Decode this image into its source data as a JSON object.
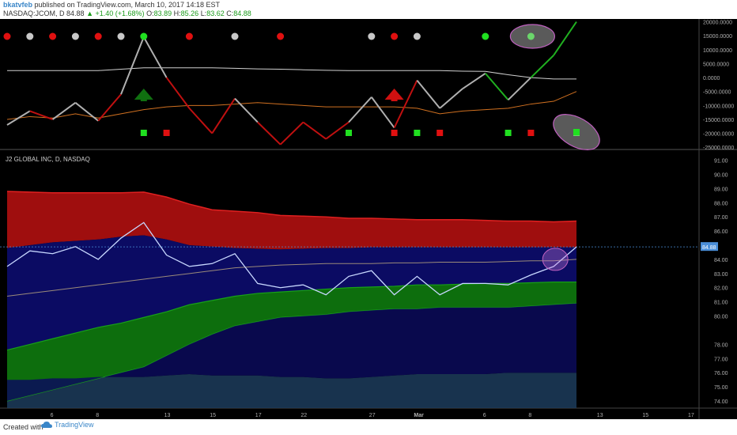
{
  "header": {
    "author": "bkatvfeb",
    "published": "published on TradingView.com, March 10, 2017 14:18 EST",
    "symbol": "NASDAQ:JCOM, D",
    "price": "84.88",
    "change_arrow": "▲",
    "change": "+1.40 (+1.68%)",
    "o_label": "O:",
    "o_value": "83.89",
    "h_label": "H:",
    "h_value": "85.26",
    "l_label": "L:",
    "l_value": "83.62",
    "c_label": "C:",
    "c_value": "84.88"
  },
  "footer": {
    "created": "Created with",
    "brand": "TradingView"
  },
  "colors": {
    "background": "#000000",
    "red_band": "#b01010",
    "blue_band": "#0c0c6e",
    "green_band": "#0e7a0e",
    "price_line": "#c8d8ff",
    "osc_red": "#c01010",
    "osc_grey": "#b0b0b0",
    "osc_green": "#20b020",
    "orange_ma": "#d07020",
    "last_price_tag": "#4a8ed8",
    "highlight_ellipse": "#c060c0"
  },
  "chart_data": [
    {
      "type": "line",
      "panel": "oscillator",
      "y_ticks": [
        20000,
        15000,
        10000,
        5000,
        0,
        -5000,
        -10000,
        -15000,
        -20000,
        -25000
      ],
      "y_tick_labels": [
        "20000.0000",
        "15000.0000",
        "10000.0000",
        "5000.0000",
        "0.0000",
        "-5000.0000",
        "-10000.0000",
        "-15000.0000",
        "-20000.0000",
        "-25000.0000"
      ],
      "ylim": [
        -25500,
        21000
      ],
      "x": [
        0,
        1,
        2,
        3,
        4,
        5,
        6,
        7,
        8,
        9,
        10,
        11,
        12,
        13,
        14,
        15,
        16,
        17,
        18,
        19,
        20,
        21,
        22,
        23,
        24,
        25
      ],
      "series": [
        {
          "values": [
            -17000,
            -12000,
            -15000,
            -9000,
            -15500,
            -6000,
            14500,
            0,
            -11000,
            -20000,
            -7500,
            -16000,
            -24000,
            -16000,
            -22000,
            -16000,
            -7000,
            -18000,
            -1000,
            -11000,
            -4000,
            1500,
            -8000,
            0,
            8000,
            20000
          ],
          "segment_colors": [
            "grey",
            "red",
            "grey",
            "grey",
            "red",
            "grey",
            "grey",
            "red",
            "red",
            "red",
            "grey",
            "red",
            "red",
            "red",
            "red",
            "grey",
            "grey",
            "red",
            "grey",
            "grey",
            "grey",
            "green",
            "grey",
            "green",
            "green"
          ]
        },
        {
          "values": [
            2500,
            2500,
            2500,
            2500,
            2500,
            3000,
            3500,
            3500,
            3500,
            3500,
            3300,
            3100,
            3000,
            2800,
            2600,
            2500,
            2500,
            2500,
            2500,
            2500,
            2300,
            2200,
            1000,
            0,
            -500,
            -500
          ]
        },
        {
          "values": [
            -15000,
            -14000,
            -14500,
            -13000,
            -14500,
            -13000,
            -11500,
            -10500,
            -10000,
            -10000,
            -9500,
            -9000,
            -9500,
            -10000,
            -10500,
            -10500,
            -10500,
            -10500,
            -11000,
            -13000,
            -12000,
            -11500,
            -11000,
            -9500,
            -8500,
            -5000
          ]
        }
      ],
      "signal_dots": [
        {
          "x": 0,
          "color": "red"
        },
        {
          "x": 1,
          "color": "grey"
        },
        {
          "x": 2,
          "color": "red"
        },
        {
          "x": 3,
          "color": "grey"
        },
        {
          "x": 4,
          "color": "red"
        },
        {
          "x": 5,
          "color": "grey"
        },
        {
          "x": 6,
          "color": "green"
        },
        {
          "x": 8,
          "color": "red"
        },
        {
          "x": 10,
          "color": "grey"
        },
        {
          "x": 12,
          "color": "red"
        },
        {
          "x": 16,
          "color": "grey"
        },
        {
          "x": 17,
          "color": "red"
        },
        {
          "x": 18,
          "color": "grey"
        },
        {
          "x": 21,
          "color": "green"
        },
        {
          "x": 23,
          "color": "green"
        }
      ],
      "signal_squares": [
        {
          "x": 6,
          "color": "green"
        },
        {
          "x": 7,
          "color": "red"
        },
        {
          "x": 15,
          "color": "green"
        },
        {
          "x": 17,
          "color": "red"
        },
        {
          "x": 18,
          "color": "green"
        },
        {
          "x": 19,
          "color": "red"
        },
        {
          "x": 22,
          "color": "green"
        },
        {
          "x": 23,
          "color": "red"
        },
        {
          "x": 25,
          "color": "green"
        }
      ],
      "arrows": [
        {
          "x": 6,
          "direction": "up",
          "color": "green"
        },
        {
          "x": 17,
          "direction": "up",
          "color": "red"
        }
      ]
    },
    {
      "type": "line",
      "panel": "price",
      "title": "J2 GLOBAL INC, D, NASDAQ",
      "y_ticks": [
        74,
        75,
        76,
        77,
        78,
        80,
        81,
        82,
        83,
        84,
        86,
        87,
        88,
        89,
        90,
        91
      ],
      "y_tick_labels": [
        "74.00",
        "75.00",
        "76.00",
        "77.00",
        "78.00",
        "80.00",
        "81.00",
        "82.00",
        "83.00",
        "84.00",
        "86.00",
        "87.00",
        "88.00",
        "89.00",
        "90.00",
        "91.00"
      ],
      "ylim": [
        73.5,
        91.7
      ],
      "last_price": "84.88",
      "x_ticks": [
        {
          "x": 2,
          "label": "6"
        },
        {
          "x": 4,
          "label": "8"
        },
        {
          "x": 7,
          "label": "13"
        },
        {
          "x": 9,
          "label": "15"
        },
        {
          "x": 11,
          "label": "17"
        },
        {
          "x": 13,
          "label": "22"
        },
        {
          "x": 16,
          "label": "27"
        },
        {
          "x": 18,
          "label": "Mar"
        },
        {
          "x": 21,
          "label": "6"
        },
        {
          "x": 23,
          "label": "8"
        },
        {
          "x": 26,
          "label": "13"
        },
        {
          "x": 28,
          "label": "15"
        },
        {
          "x": 30,
          "label": "17"
        }
      ],
      "x": [
        0,
        1,
        2,
        3,
        4,
        5,
        6,
        7,
        8,
        9,
        10,
        11,
        12,
        13,
        14,
        15,
        16,
        17,
        18,
        19,
        20,
        21,
        22,
        23,
        24,
        25
      ],
      "price": [
        83.5,
        84.6,
        84.4,
        84.9,
        84.0,
        85.5,
        86.6,
        84.3,
        83.5,
        83.7,
        84.4,
        82.3,
        82.0,
        82.2,
        81.5,
        82.8,
        83.2,
        81.5,
        82.8,
        81.5,
        82.3,
        82.3,
        82.2,
        82.9,
        83.5,
        84.88
      ],
      "red_band_upper": [
        88.8,
        88.75,
        88.7,
        88.7,
        88.7,
        88.7,
        88.75,
        88.4,
        87.9,
        87.5,
        87.4,
        87.3,
        87.1,
        87.05,
        87.0,
        86.9,
        86.9,
        86.85,
        86.8,
        86.8,
        86.8,
        86.75,
        86.7,
        86.7,
        86.65,
        86.7
      ],
      "blue_band_upper": [
        84.8,
        85.0,
        85.2,
        85.3,
        85.4,
        85.6,
        85.7,
        85.4,
        85.0,
        84.9,
        84.8,
        84.75,
        84.7,
        84.75,
        84.8,
        84.8,
        84.85,
        84.85,
        84.85,
        84.85,
        84.85,
        84.85,
        84.85,
        84.85,
        84.85,
        84.85
      ],
      "ma_line": [
        81.4,
        81.6,
        81.8,
        82.0,
        82.2,
        82.4,
        82.6,
        82.8,
        83.0,
        83.2,
        83.4,
        83.5,
        83.6,
        83.65,
        83.7,
        83.7,
        83.7,
        83.75,
        83.75,
        83.8,
        83.8,
        83.8,
        83.85,
        83.9,
        83.9,
        84.0
      ],
      "green_band_upper": [
        77.6,
        78.0,
        78.4,
        78.8,
        79.2,
        79.5,
        79.9,
        80.3,
        80.8,
        81.1,
        81.4,
        81.6,
        81.7,
        81.8,
        81.9,
        82.0,
        82.05,
        82.1,
        82.2,
        82.2,
        82.25,
        82.3,
        82.3,
        82.35,
        82.4,
        82.4
      ],
      "green_band_lower": [
        74.0,
        74.4,
        74.8,
        75.2,
        75.6,
        76.0,
        76.4,
        77.2,
        78.0,
        78.7,
        79.3,
        79.6,
        79.9,
        80.0,
        80.1,
        80.3,
        80.4,
        80.5,
        80.5,
        80.6,
        80.6,
        80.6,
        80.6,
        80.7,
        80.8,
        80.9
      ],
      "volume_band_top": [
        75.5,
        75.5,
        75.6,
        75.6,
        75.7,
        75.7,
        75.7,
        75.8,
        75.9,
        75.8,
        75.8,
        75.8,
        75.7,
        75.7,
        75.6,
        75.6,
        75.7,
        75.8,
        75.9,
        75.9,
        75.9,
        75.9,
        76.0,
        76.0,
        76.0,
        76.0
      ]
    }
  ]
}
